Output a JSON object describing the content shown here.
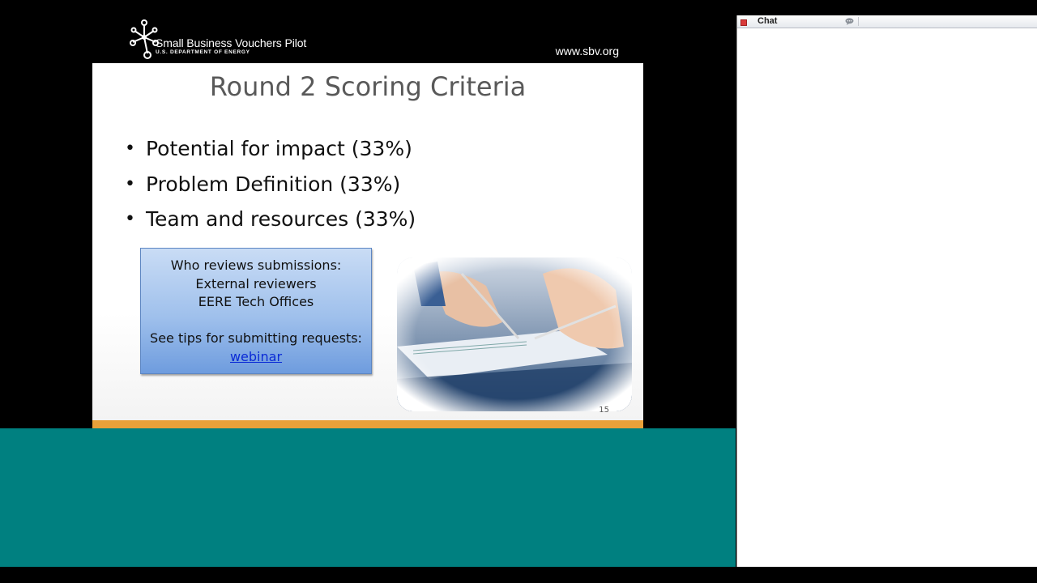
{
  "slide": {
    "brand_name": "Small Business Vouchers Pilot",
    "brand_sub": "U.S. DEPARTMENT OF ENERGY",
    "website": "www.sbv.org",
    "title": "Round 2 Scoring Criteria",
    "bullets": [
      "Potential for impact (33%)",
      "Problem Definition (33%)",
      "Team and resources (33%)"
    ],
    "review_box": {
      "line1": "Who reviews submissions:",
      "line2": "External reviewers",
      "line3": "EERE  Tech Offices",
      "line4": "See tips for submitting requests:",
      "link": "webinar"
    },
    "page_number": "15"
  },
  "chat": {
    "title": "Chat"
  },
  "colors": {
    "teal_background": "#008080",
    "orange_bar": "#e8a13a",
    "review_box": "#9fc0ec"
  }
}
